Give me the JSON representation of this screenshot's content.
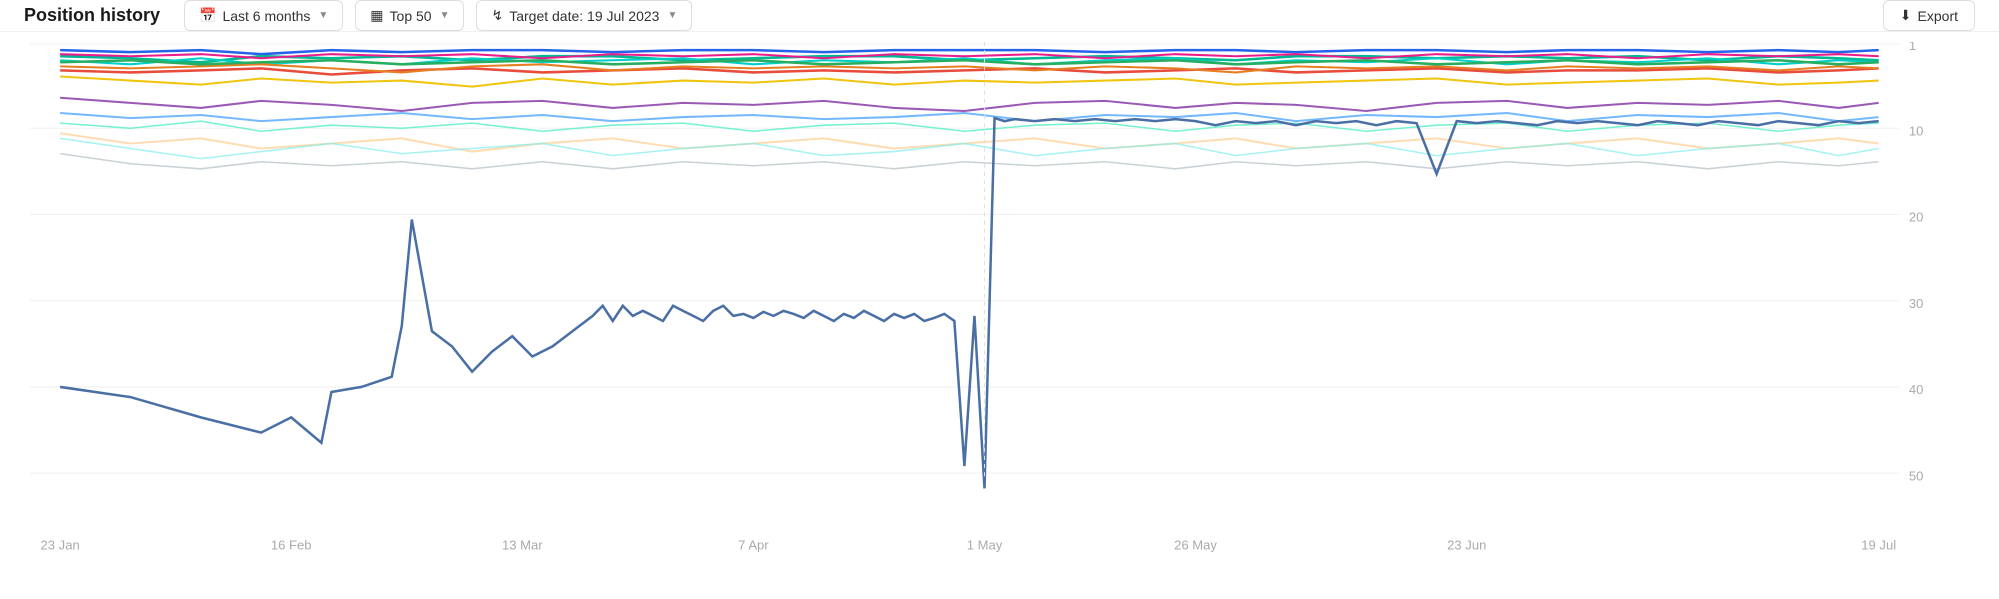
{
  "toolbar": {
    "title": "Position history",
    "period_label": "Last 6 months",
    "top_label": "Top 50",
    "target_label": "Target date: 19 Jul 2023",
    "export_label": "Export",
    "period_icon": "calendar-icon",
    "top_icon": "table-icon",
    "target_icon": "trend-icon",
    "export_icon": "download-icon"
  },
  "chart": {
    "y_axis": [
      "1",
      "10",
      "20",
      "30",
      "40",
      "50"
    ],
    "x_axis": [
      "23 Jan",
      "16 Feb",
      "13 Mar",
      "7 Apr",
      "1 May",
      "26 May",
      "23 Jun",
      "19 Jul"
    ],
    "colors": {
      "blue_main": "#4a6fa5",
      "cyan": "#2bcbcb",
      "green": "#2ecc71",
      "dark_green": "#27ae60",
      "red": "#e74c3c",
      "orange": "#e67e22",
      "yellow": "#f1c40f",
      "purple": "#9b59b6",
      "pink": "#e91e8c",
      "teal": "#1abc9c",
      "light_blue": "#74b9ff",
      "light_teal": "#a8e6cf",
      "light_orange": "#ffd8a8",
      "gray": "#95a5a6"
    }
  }
}
